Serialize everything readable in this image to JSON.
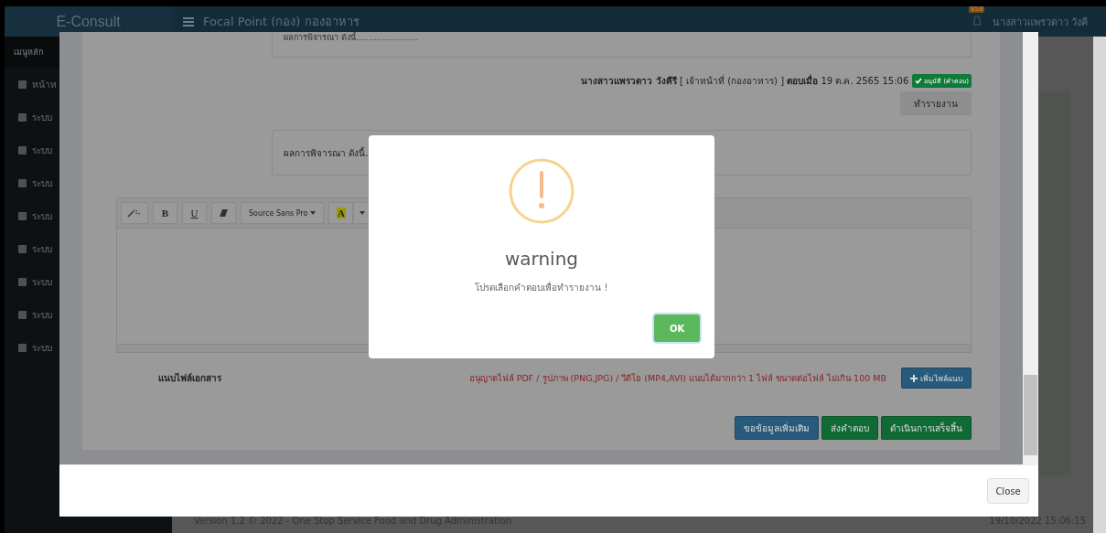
{
  "header": {
    "logo": "E-Consult",
    "title": "Focal Point (กอง) กองอาหาร",
    "badge": "858",
    "user": "นางสาวแพรวดาว วังคี"
  },
  "sidebar": {
    "heading": "เมนูหลัก",
    "items": [
      {
        "label": "หน้าห"
      },
      {
        "label": "ระบบ"
      },
      {
        "label": "ระบบ"
      },
      {
        "label": "ระบบ"
      },
      {
        "label": "ระบบ"
      },
      {
        "label": "ระบบ"
      },
      {
        "label": "ระบบ"
      },
      {
        "label": "ระบบ"
      },
      {
        "label": "ระบบ"
      }
    ]
  },
  "footer": {
    "version": "Version 1.2 © 2022 - One Stop Service Food and Drug Administration",
    "timestamp": "19/10/2022 15:06:15"
  },
  "modal": {
    "previous_answer": "ผลการพิจารณา ดังนี้........................",
    "reply_meta": {
      "name": "นางสาวแพรวดาว วังคีรี",
      "role": "[ เจ้าหน้าที่ (กองอาหาร) ]",
      "answered_label": "ตอบเมื่อ",
      "date": "19 ต.ค. 2565 15:06",
      "status": "อนุมัติ (คำตอบ)"
    },
    "report_button": "ทำรายงาน",
    "answer_text": "ผลการพิจารณา ดังนี้.",
    "toolbar": [
      {
        "kind": "magic"
      },
      {
        "kind": "bold",
        "label": "B"
      },
      {
        "kind": "underline",
        "label": "U"
      },
      {
        "kind": "eraser"
      },
      {
        "kind": "font",
        "label": "Source Sans Pro"
      },
      {
        "kind": "color",
        "label": "A"
      }
    ],
    "attach_label": "แนบไฟล์เอกสาร",
    "attach_note": "อนุญาตไฟล์ PDF / รูปภาพ (PNG,JPG) / วีดีโอ (MP4,AVI) แนบได้มากกว่า 1 ไฟล์ ขนาดต่อไฟล์ ไม่เกิน 100 MB",
    "attach_button": "เพิ่มไฟล์แนบ",
    "actions": [
      {
        "label": "ขอข้อมูลเพิ่มเติม",
        "kind": "primary"
      },
      {
        "label": "ส่งคำตอบ",
        "kind": "success"
      },
      {
        "label": "ดำเนินการเสร็จสิ้น",
        "kind": "success"
      }
    ],
    "close_button": "Close"
  },
  "dialog": {
    "title": "warning",
    "message": "โปรดเลือกคำตอบเพื่อทำรายงาน !",
    "ok_button": "OK"
  }
}
